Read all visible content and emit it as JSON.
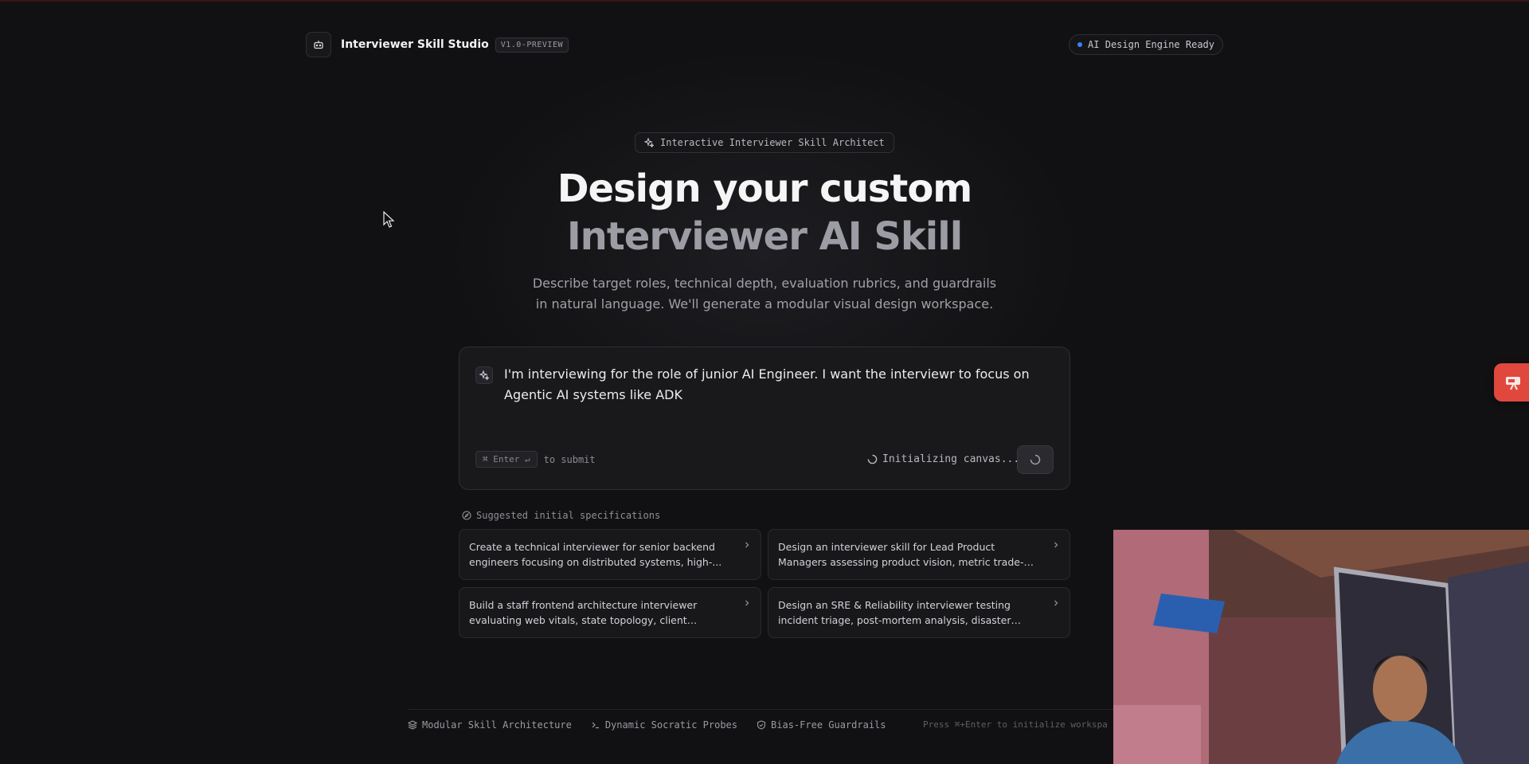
{
  "header": {
    "brand_title": "Interviewer Skill Studio",
    "version": "V1.0-PREVIEW",
    "status": "AI Design Engine Ready",
    "status_color": "#3b82f6"
  },
  "hero": {
    "pill": "Interactive Interviewer Skill Architect",
    "title": "Design your custom",
    "subtitle": "Interviewer AI Skill",
    "description": "Describe target roles, technical depth, evaluation rubrics, and guardrails in natural language. We'll generate a modular visual design workspace."
  },
  "prompt": {
    "text": "I'm interviewing for the role of junior AI Engineer. I want the interviewr to focus on Agentic AI systems like ADK",
    "kbd": "⌘ Enter ↵",
    "submit_hint": "to submit",
    "init_status": "Initializing canvas..."
  },
  "suggestions": {
    "heading": "Suggested initial specifications",
    "items": [
      {
        "text": "Create a technical interviewer for senior backend engineers focusing on distributed systems, high-..."
      },
      {
        "text": "Design an interviewer skill for Lead Product Managers assessing product vision, metric trade-offs, and cross-..."
      },
      {
        "text": "Build a staff frontend architecture interviewer evaluating web vitals, state topology, client performance, and desig..."
      },
      {
        "text": "Design an SRE & Reliability interviewer testing incident triage, post-mortem analysis, disaster recovery, and zero..."
      }
    ]
  },
  "footer": {
    "items": [
      {
        "label": "Modular Skill Architecture",
        "icon": "layers-icon"
      },
      {
        "label": "Dynamic Socratic Probes",
        "icon": "terminal-icon"
      },
      {
        "label": "Bias-Free Guardrails",
        "icon": "shield-icon"
      }
    ],
    "hint": "Press ⌘+Enter to initialize workspa"
  },
  "colors": {
    "background": "#111113",
    "accent_red": "#e0483e"
  }
}
